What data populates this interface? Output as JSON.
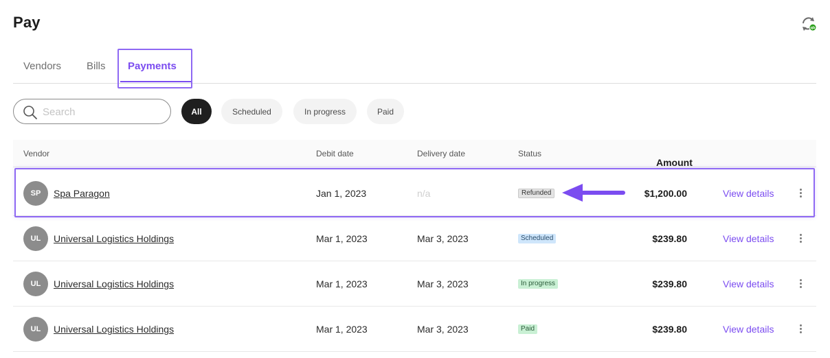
{
  "page": {
    "title": "Pay"
  },
  "tabs": [
    {
      "label": "Vendors"
    },
    {
      "label": "Bills"
    },
    {
      "label": "Payments"
    }
  ],
  "search": {
    "placeholder": "Search",
    "value": ""
  },
  "filters": [
    {
      "label": "All"
    },
    {
      "label": "Scheduled"
    },
    {
      "label": "In progress"
    },
    {
      "label": "Paid"
    }
  ],
  "table": {
    "headers": {
      "vendor": "Vendor",
      "debit_date": "Debit date",
      "delivery_date": "Delivery date",
      "status": "Status",
      "amount": "Amount"
    },
    "rows": [
      {
        "initials": "SP",
        "vendor": "Spa Paragon",
        "debit_date": "Jan 1, 2023",
        "delivery_date": "n/a",
        "status": "Refunded",
        "amount": "$1,200.00",
        "action": "View details"
      },
      {
        "initials": "UL",
        "vendor": "Universal Logistics Holdings",
        "debit_date": "Mar 1, 2023",
        "delivery_date": "Mar 3, 2023",
        "status": "Scheduled",
        "amount": "$239.80",
        "action": "View details"
      },
      {
        "initials": "UL",
        "vendor": "Universal Logistics Holdings",
        "debit_date": "Mar 1, 2023",
        "delivery_date": "Mar 3, 2023",
        "status": "In progress",
        "amount": "$239.80",
        "action": "View details"
      },
      {
        "initials": "UL",
        "vendor": "Universal Logistics Holdings",
        "debit_date": "Mar 1, 2023",
        "delivery_date": "Mar 3, 2023",
        "status": "Paid",
        "amount": "$239.80",
        "action": "View details"
      }
    ]
  },
  "icons": {
    "sync": "quickbooks-sync-icon",
    "search": "search-icon",
    "more": "more-vertical-icon"
  },
  "colors": {
    "accent": "#7b4cf0",
    "highlight": "#8e68f3",
    "active_chip": "#1f1f1f",
    "scheduled_badge": "#cfe6fb",
    "progress_badge": "#c9f0d4",
    "refunded_badge": "#e4e4e4",
    "sync_badge": "#2ca01c"
  }
}
